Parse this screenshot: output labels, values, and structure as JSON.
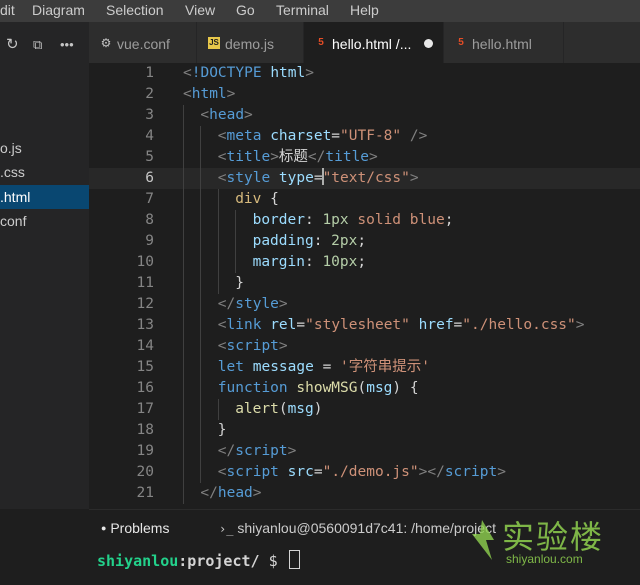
{
  "menu": [
    "dit",
    "Diagram",
    "Selection",
    "View",
    "Go",
    "Terminal",
    "Help"
  ],
  "sidebar": {
    "files": [
      {
        "label": "o.js",
        "active": false
      },
      {
        "label": ".css",
        "active": false
      },
      {
        "label": ".html",
        "active": true
      },
      {
        "label": "conf",
        "active": false
      }
    ]
  },
  "tabs": [
    {
      "label": "vue.conf",
      "icon": "gear-icon",
      "active": false,
      "dirty": false
    },
    {
      "label": "demo.js",
      "icon": "js-icon",
      "active": false,
      "dirty": false
    },
    {
      "label": "hello.html /...",
      "icon": "html5-icon",
      "active": true,
      "dirty": true
    },
    {
      "label": "hello.html",
      "icon": "html5-icon",
      "active": false,
      "dirty": false
    }
  ],
  "editor": {
    "current_line": 6,
    "lines": [
      {
        "n": "1",
        "indent": 0,
        "tokens": [
          [
            "t",
            "<"
          ],
          [
            "tag",
            "!DOCTYPE"
          ],
          [
            "txt",
            " "
          ],
          [
            "attr",
            "html"
          ],
          [
            "t",
            ">"
          ]
        ]
      },
      {
        "n": "2",
        "indent": 0,
        "tokens": [
          [
            "t",
            "<"
          ],
          [
            "tag",
            "html"
          ],
          [
            "t",
            ">"
          ]
        ]
      },
      {
        "n": "3",
        "indent": 1,
        "tokens": [
          [
            "t",
            "<"
          ],
          [
            "tag",
            "head"
          ],
          [
            "t",
            ">"
          ]
        ]
      },
      {
        "n": "4",
        "indent": 2,
        "tokens": [
          [
            "t",
            "<"
          ],
          [
            "tag",
            "meta"
          ],
          [
            "txt",
            " "
          ],
          [
            "attr",
            "charset"
          ],
          [
            "txt",
            "="
          ],
          [
            "str",
            "\"UTF-8\""
          ],
          [
            "txt",
            " "
          ],
          [
            "t",
            "/>"
          ]
        ]
      },
      {
        "n": "5",
        "indent": 2,
        "tokens": [
          [
            "t",
            "<"
          ],
          [
            "tag",
            "title"
          ],
          [
            "t",
            ">"
          ],
          [
            "txt",
            "标题"
          ],
          [
            "t",
            "</"
          ],
          [
            "tag",
            "title"
          ],
          [
            "t",
            ">"
          ]
        ]
      },
      {
        "n": "6",
        "indent": 2,
        "tokens": [
          [
            "t",
            "<"
          ],
          [
            "tag",
            "style"
          ],
          [
            "txt",
            " "
          ],
          [
            "attr",
            "type"
          ],
          [
            "txt",
            "="
          ],
          [
            "cursor",
            ""
          ],
          [
            "str",
            "\"text/css\""
          ],
          [
            "t",
            ">"
          ]
        ]
      },
      {
        "n": "7",
        "indent": 3,
        "tokens": [
          [
            "sel",
            "div"
          ],
          [
            "txt",
            " {"
          ]
        ]
      },
      {
        "n": "8",
        "indent": 4,
        "tokens": [
          [
            "prop",
            "border"
          ],
          [
            "txt",
            ": "
          ],
          [
            "num",
            "1px"
          ],
          [
            "txt",
            " "
          ],
          [
            "str",
            "solid blue"
          ],
          [
            "txt",
            ";"
          ]
        ]
      },
      {
        "n": "9",
        "indent": 4,
        "tokens": [
          [
            "prop",
            "padding"
          ],
          [
            "txt",
            ": "
          ],
          [
            "num",
            "2px"
          ],
          [
            "txt",
            ";"
          ]
        ]
      },
      {
        "n": "10",
        "indent": 4,
        "tokens": [
          [
            "prop",
            "margin"
          ],
          [
            "txt",
            ": "
          ],
          [
            "num",
            "10px"
          ],
          [
            "txt",
            ";"
          ]
        ]
      },
      {
        "n": "11",
        "indent": 3,
        "tokens": [
          [
            "txt",
            "}"
          ]
        ]
      },
      {
        "n": "12",
        "indent": 2,
        "tokens": [
          [
            "t",
            "</"
          ],
          [
            "tag",
            "style"
          ],
          [
            "t",
            ">"
          ]
        ]
      },
      {
        "n": "13",
        "indent": 2,
        "tokens": [
          [
            "t",
            "<"
          ],
          [
            "tag",
            "link"
          ],
          [
            "txt",
            " "
          ],
          [
            "attr",
            "rel"
          ],
          [
            "txt",
            "="
          ],
          [
            "str",
            "\"stylesheet\""
          ],
          [
            "txt",
            " "
          ],
          [
            "attr",
            "href"
          ],
          [
            "txt",
            "="
          ],
          [
            "str",
            "\"./hello.css\""
          ],
          [
            "t",
            ">"
          ]
        ]
      },
      {
        "n": "14",
        "indent": 2,
        "tokens": [
          [
            "t",
            "<"
          ],
          [
            "tag",
            "script"
          ],
          [
            "t",
            ">"
          ]
        ]
      },
      {
        "n": "15",
        "indent": 2,
        "tokens": [
          [
            "kw",
            "let"
          ],
          [
            "txt",
            " "
          ],
          [
            "attr",
            "message"
          ],
          [
            "txt",
            " = "
          ],
          [
            "str",
            "'字符串提示'"
          ]
        ]
      },
      {
        "n": "16",
        "indent": 2,
        "tokens": [
          [
            "kw",
            "function"
          ],
          [
            "txt",
            " "
          ],
          [
            "fn",
            "showMSG"
          ],
          [
            "txt",
            "("
          ],
          [
            "attr",
            "msg"
          ],
          [
            "txt",
            ") {"
          ]
        ]
      },
      {
        "n": "17",
        "indent": 3,
        "tokens": [
          [
            "fn",
            "alert"
          ],
          [
            "txt",
            "("
          ],
          [
            "attr",
            "msg"
          ],
          [
            "txt",
            ")"
          ]
        ]
      },
      {
        "n": "18",
        "indent": 2,
        "tokens": [
          [
            "txt",
            "}"
          ]
        ]
      },
      {
        "n": "19",
        "indent": 2,
        "tokens": [
          [
            "t",
            "</"
          ],
          [
            "tag",
            "script"
          ],
          [
            "t",
            ">"
          ]
        ]
      },
      {
        "n": "20",
        "indent": 2,
        "tokens": [
          [
            "t",
            "<"
          ],
          [
            "tag",
            "script"
          ],
          [
            "txt",
            " "
          ],
          [
            "attr",
            "src"
          ],
          [
            "txt",
            "="
          ],
          [
            "str",
            "\"./demo.js\""
          ],
          [
            "t",
            "></"
          ],
          [
            "tag",
            "script"
          ],
          [
            "t",
            ">"
          ]
        ]
      },
      {
        "n": "21",
        "indent": 1,
        "tokens": [
          [
            "t",
            "</"
          ],
          [
            "tag",
            "head"
          ],
          [
            "t",
            ">"
          ]
        ]
      }
    ]
  },
  "panel": {
    "problems_label": "Problems",
    "terminal_label": "shiyanlou@0560091d7c41: /home/project"
  },
  "terminal": {
    "user": "shiyanlou",
    "path": ":project/",
    "prompt": " $ "
  },
  "watermark": {
    "brand": "实验楼",
    "url": "shiyanlou.com"
  },
  "colors": {
    "editor_bg": "#1e1e1e",
    "sidebar_bg": "#252526",
    "active_file_bg": "#094771",
    "tag": "#569cd6",
    "string": "#ce9178",
    "attribute": "#9cdcfe"
  }
}
